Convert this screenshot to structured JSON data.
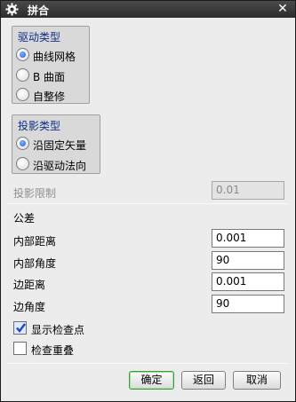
{
  "window": {
    "title": "拼合",
    "close_icon": "close-icon",
    "menu_icon": "gear-icon"
  },
  "drive_type": {
    "title": "驱动类型",
    "options": [
      {
        "label": "曲线网格",
        "selected": true
      },
      {
        "label": "B 曲面",
        "selected": false
      },
      {
        "label": "自整修",
        "selected": false
      }
    ]
  },
  "projection_type": {
    "title": "投影类型",
    "options": [
      {
        "label": "沿固定矢量",
        "selected": true
      },
      {
        "label": "沿驱动法向",
        "selected": false
      }
    ]
  },
  "projection_limit": {
    "label": "投影限制",
    "value": "0.01",
    "enabled": false
  },
  "tolerance": {
    "title": "公差",
    "fields": [
      {
        "label": "内部距离",
        "value": "0.001"
      },
      {
        "label": "内部角度",
        "value": "90"
      },
      {
        "label": "边距离",
        "value": "0.001"
      },
      {
        "label": "边角度",
        "value": "90"
      }
    ]
  },
  "options": {
    "show_checkpoints": {
      "label": "显示检查点",
      "checked": true
    },
    "check_overlap": {
      "label": "检查重叠",
      "checked": false
    }
  },
  "buttons": {
    "ok": "确定",
    "back": "返回",
    "cancel": "取消"
  },
  "colors": {
    "accent": "#0f2f86",
    "primary_border": "#3e9a3e"
  }
}
